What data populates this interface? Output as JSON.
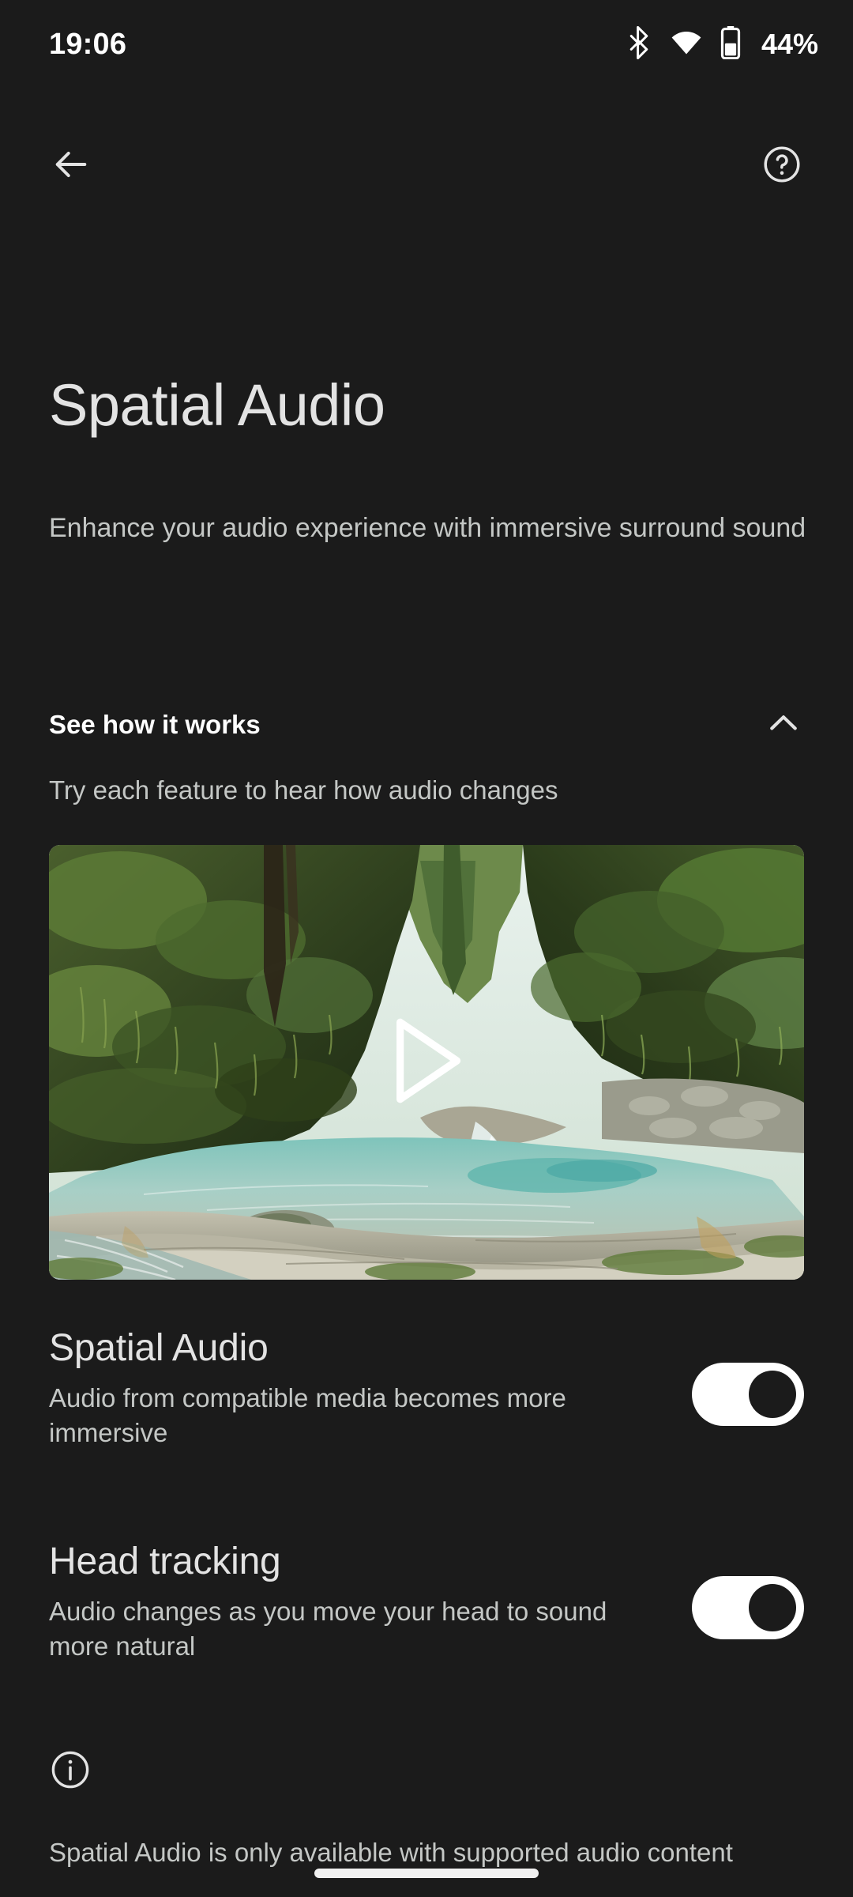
{
  "status_bar": {
    "clock": "19:06",
    "battery_percent": "44%",
    "icons": [
      "bluetooth-icon",
      "wifi-icon",
      "battery-icon"
    ]
  },
  "app_bar": {
    "back_label": "back-arrow-icon",
    "help_label": "help-icon"
  },
  "header": {
    "title": "Spatial Audio",
    "subtitle": "Enhance your audio experience with immersive surround sound"
  },
  "demo_section": {
    "title": "See how it works",
    "subtitle": "Try each feature to hear how audio changes",
    "expanded": true,
    "chevron": "chevron-up-icon",
    "video": {
      "play_icon": "play-triangle-icon",
      "alt": "Forest gorge with a clear shallow stream over rock"
    }
  },
  "settings": [
    {
      "title": "Spatial Audio",
      "description": "Audio from compatible media becomes more immersive",
      "toggle_state": "on"
    },
    {
      "title": "Head tracking",
      "description": "Audio changes as you move your head to sound more natural",
      "toggle_state": "on"
    }
  ],
  "footer": {
    "icon": "info-icon",
    "note": "Spatial Audio is only available with supported audio content"
  },
  "colors": {
    "background": "#1b1b1b",
    "primary_text": "#e3e3e3",
    "secondary_text": "#c4c7c5",
    "toggle_on_track": "#ffffff",
    "toggle_knob": "#1b1b1b",
    "gesture_bar": "#f1f1f1"
  }
}
